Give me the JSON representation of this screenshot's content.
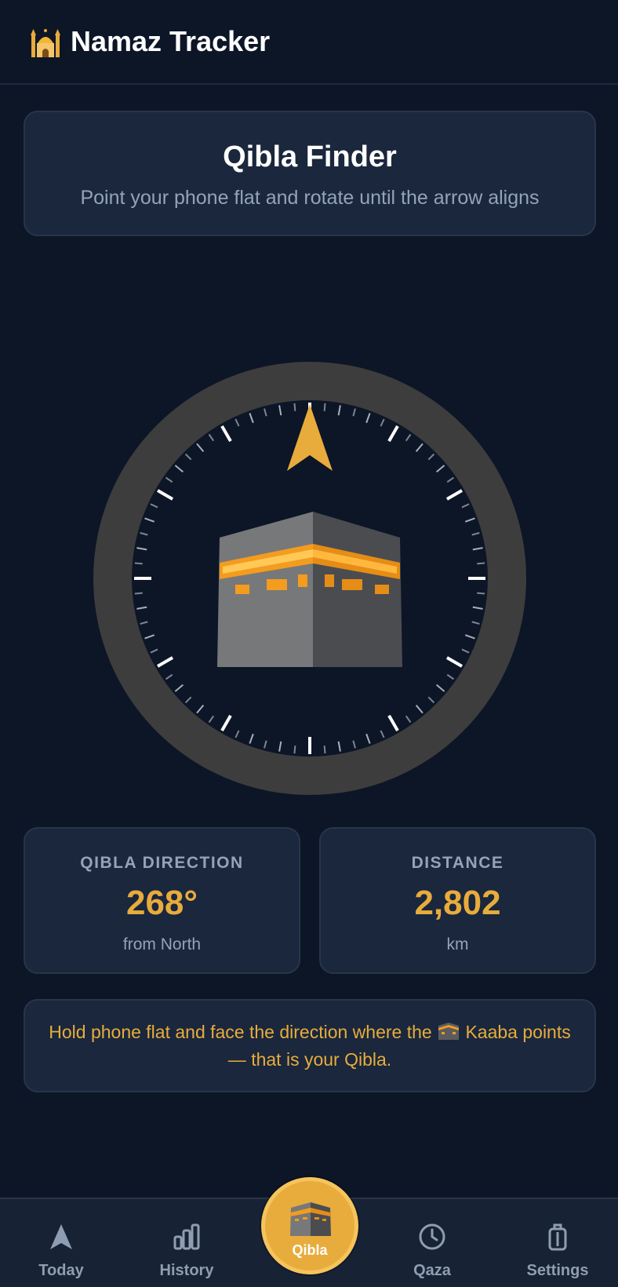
{
  "header": {
    "title": "Namaz Tracker",
    "logo_icon": "mosque-icon"
  },
  "hero": {
    "title": "Qibla Finder",
    "subtitle": "Point your phone flat and rotate until the arrow aligns"
  },
  "compass": {
    "center_icon": "kaaba-icon",
    "pointer_icon": "north-arrow-icon"
  },
  "stats": [
    {
      "label": "QIBLA DIRECTION",
      "value": "268°",
      "unit": "from North"
    },
    {
      "label": "DISTANCE",
      "value": "2,802",
      "unit": "km"
    }
  ],
  "tip": {
    "before": "Hold phone flat and face the direction where the ",
    "after": " Kaaba points — that is your Qibla.",
    "icon": "kaaba-icon"
  },
  "nav": {
    "items": [
      {
        "label": "Today",
        "icon": "navigation-arrow-icon"
      },
      {
        "label": "History",
        "icon": "bar-chart-icon"
      },
      {
        "label": "Qibla",
        "icon": "kaaba-icon",
        "active": true
      },
      {
        "label": "Qaza",
        "icon": "clock-icon"
      },
      {
        "label": "Settings",
        "icon": "settings-icon"
      }
    ]
  },
  "colors": {
    "background": "#0d1627",
    "card": "#1a273c",
    "accent": "#e8ac3c",
    "muted_text": "#95a3b8",
    "compass_ring": "#3d3d3d"
  }
}
